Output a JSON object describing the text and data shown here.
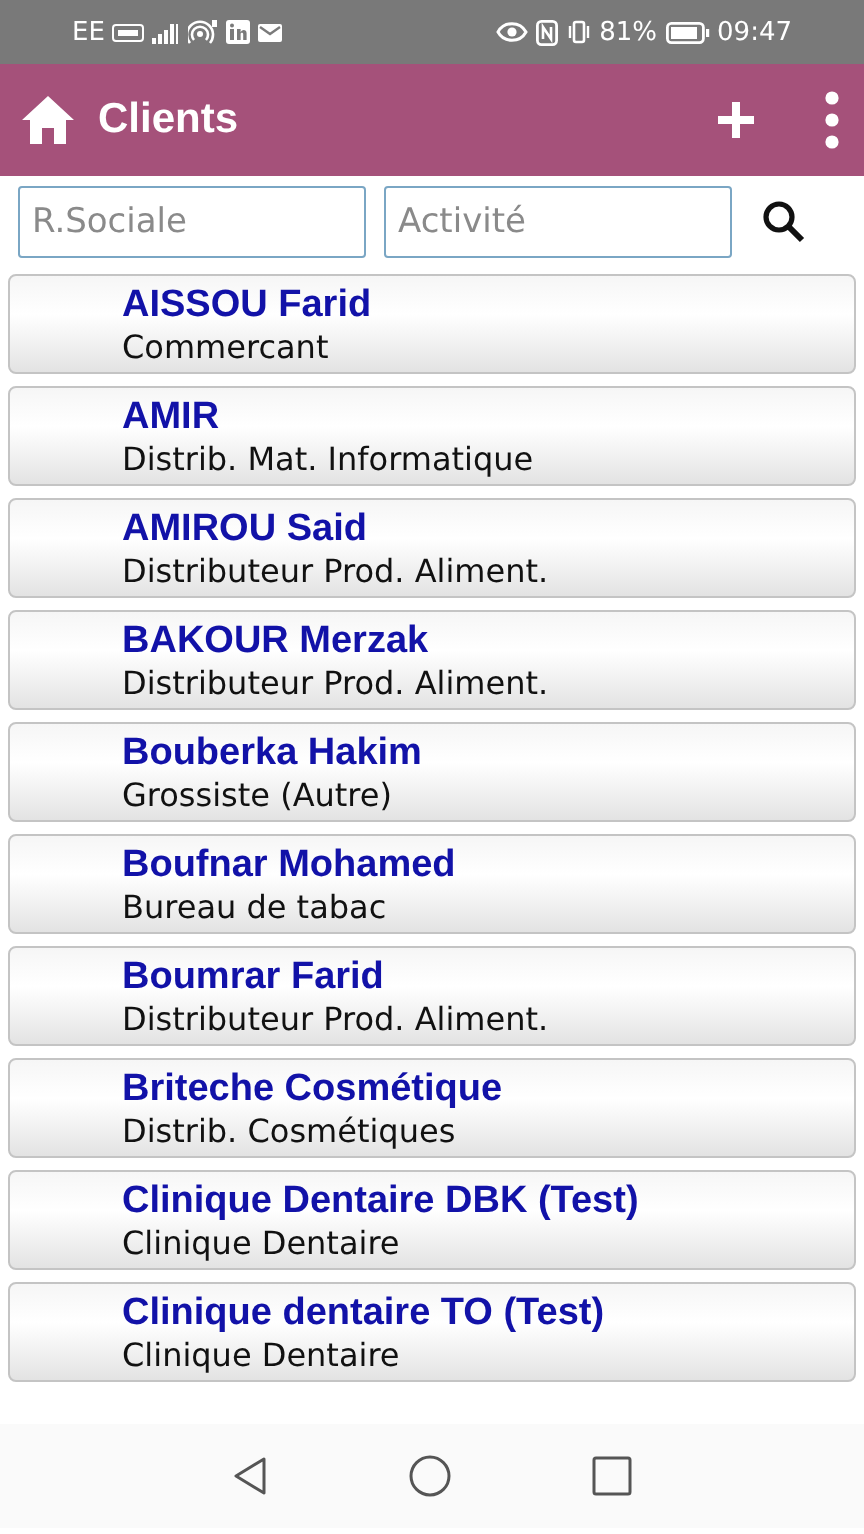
{
  "status_bar": {
    "carrier": "EE",
    "battery": "81%",
    "time": "09:47"
  },
  "app_bar": {
    "title": "Clients"
  },
  "search": {
    "fields": [
      {
        "placeholder": "R.Sociale"
      },
      {
        "placeholder": "Activité"
      }
    ]
  },
  "clients": [
    {
      "name": "AISSOU Farid",
      "activity": "Commercant"
    },
    {
      "name": "AMIR",
      "activity": "Distrib. Mat. Informatique"
    },
    {
      "name": "AMIROU Said",
      "activity": "Distributeur Prod. Aliment."
    },
    {
      "name": "BAKOUR Merzak",
      "activity": "Distributeur Prod. Aliment."
    },
    {
      "name": "Bouberka Hakim",
      "activity": "Grossiste (Autre)"
    },
    {
      "name": "Boufnar Mohamed",
      "activity": "Bureau de tabac"
    },
    {
      "name": "Boumrar Farid",
      "activity": "Distributeur Prod. Aliment."
    },
    {
      "name": "Briteche Cosmétique",
      "activity": "Distrib. Cosmétiques"
    },
    {
      "name": "Clinique Dentaire DBK (Test)",
      "activity": "Clinique Dentaire"
    },
    {
      "name": "Clinique dentaire TO (Test)",
      "activity": "Clinique Dentaire"
    }
  ]
}
